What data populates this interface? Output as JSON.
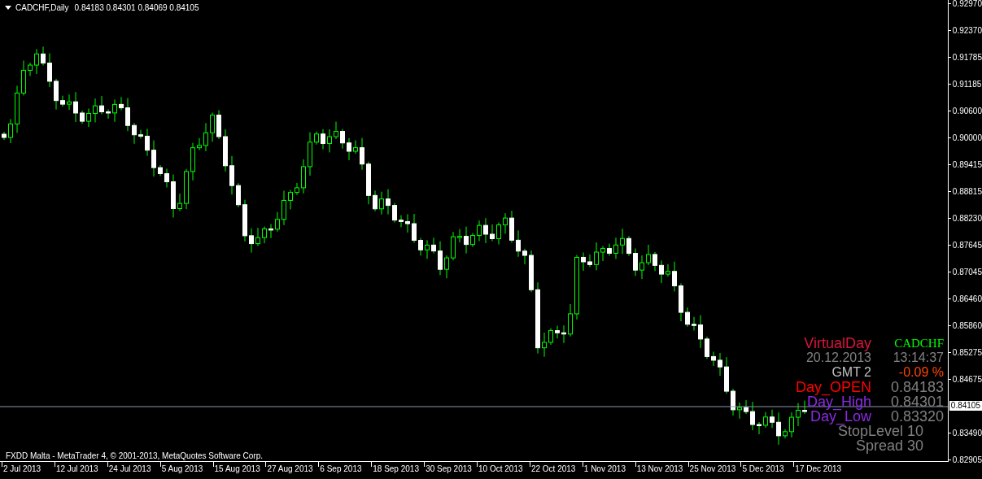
{
  "chart_header": {
    "symbol": "CADCHF,Daily",
    "prices": "0.84183 0.84301 0.84069 0.84105"
  },
  "info_panel": {
    "rows": [
      {
        "kind": "title",
        "cells": [
          {
            "text": "VirtualDay",
            "color": "#dc143c"
          },
          {
            "text": "CADCHF",
            "color": "#00ff00"
          }
        ]
      },
      {
        "kind": "pair",
        "cells": [
          {
            "text": "20.12.2013",
            "color": "#808080"
          },
          {
            "text": "13:14:37",
            "color": "#808080"
          }
        ]
      },
      {
        "kind": "pair",
        "cells": [
          {
            "text": "GMT 2",
            "color": "#c0c0c0"
          },
          {
            "text": "-0.09 %",
            "color": "#ff4500"
          }
        ]
      },
      {
        "kind": "price",
        "cells": [
          {
            "text": "Day_OPEN",
            "color": "#ff0000"
          },
          {
            "text": "0.84183",
            "color": "#808080"
          }
        ]
      },
      {
        "kind": "price",
        "cells": [
          {
            "text": "Day_High",
            "color": "#8a2be2"
          },
          {
            "text": "0.84301",
            "color": "#808080"
          }
        ]
      },
      {
        "kind": "price",
        "cells": [
          {
            "text": "Day_Low",
            "color": "#8a2be2"
          },
          {
            "text": "0.83320",
            "color": "#808080"
          }
        ]
      },
      {
        "kind": "single",
        "cells": [
          {
            "text": "StopLevel 10",
            "color": "#808080"
          }
        ]
      },
      {
        "kind": "single",
        "cells": [
          {
            "text": "Spread  30",
            "color": "#808080"
          }
        ]
      }
    ]
  },
  "footer": "FXDD Malta - MetaTrader 4, © 2001-2013, MetaQuotes Software Corp.",
  "price_axis": {
    "labels": [
      "0.92970",
      "0.92370",
      "0.91785",
      "0.91185",
      "0.90600",
      "0.90000",
      "0.89415",
      "0.88815",
      "0.88230",
      "0.87645",
      "0.87045",
      "0.86460",
      "0.85860",
      "0.85275",
      "0.84675",
      "0.83490",
      "0.82905"
    ],
    "current_price": "0.84105"
  },
  "time_axis": {
    "labels": [
      "2 Jul 2013",
      "12 Jul 2013",
      "24 Jul 2013",
      "5 Aug 2013",
      "15 Aug 2013",
      "27 Aug 2013",
      "6 Sep 2013",
      "18 Sep 2013",
      "30 Sep 2013",
      "10 Oct 2013",
      "22 Oct 2013",
      "1 Nov 2013",
      "13 Nov 2013",
      "25 Nov 2013",
      "5 Dec 2013",
      "17 Dec 2013"
    ]
  }
}
